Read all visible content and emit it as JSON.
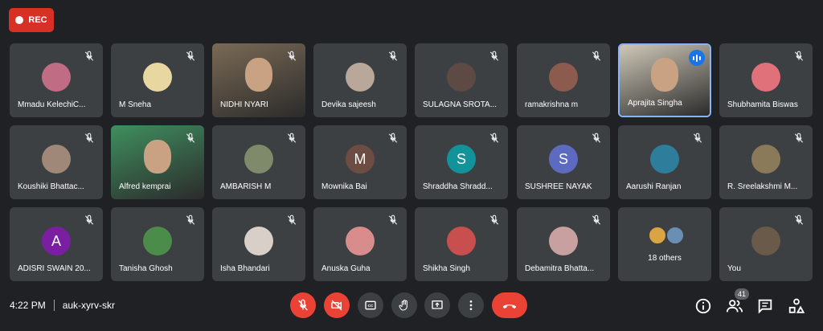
{
  "recording": {
    "label": "REC"
  },
  "participants": [
    {
      "name": "Mmadu KelechiC...",
      "avatar_type": "photo",
      "avatar_color": "#c06c84",
      "muted": true
    },
    {
      "name": "M Sneha",
      "avatar_type": "photo",
      "avatar_color": "#e8d7a0",
      "muted": true
    },
    {
      "name": "NIDHI NYARI",
      "avatar_type": "video",
      "avatar_color": "#7a6a55",
      "muted": true
    },
    {
      "name": "Devika sajeesh",
      "avatar_type": "photo",
      "avatar_color": "#b9a89a",
      "muted": true
    },
    {
      "name": "SULAGNA SROTA...",
      "avatar_type": "photo",
      "avatar_color": "#5d4a44",
      "muted": true
    },
    {
      "name": "ramakrishna m",
      "avatar_type": "photo",
      "avatar_color": "#8d5a4e",
      "muted": true
    },
    {
      "name": "Aprajita Singha",
      "avatar_type": "video",
      "avatar_color": "#cfc8b8",
      "muted": false,
      "speaking": true
    },
    {
      "name": "Shubhamita Biswas",
      "avatar_type": "photo",
      "avatar_color": "#e0707a",
      "muted": true
    },
    {
      "name": "Koushiki Bhattac...",
      "avatar_type": "photo",
      "avatar_color": "#a08878",
      "muted": true
    },
    {
      "name": "Alfred kemprai",
      "avatar_type": "video",
      "avatar_color": "#3f8f5f",
      "muted": true
    },
    {
      "name": "AMBARISH M",
      "avatar_type": "photo",
      "avatar_color": "#7e8a6a",
      "muted": true
    },
    {
      "name": "Mownika Bai",
      "avatar_type": "letter",
      "letter": "M",
      "avatar_color": "#6d4c41",
      "muted": true
    },
    {
      "name": "Shraddha Shradd...",
      "avatar_type": "letter",
      "letter": "S",
      "avatar_color": "#12939a",
      "muted": true
    },
    {
      "name": "SUSHREE NAYAK",
      "avatar_type": "letter",
      "letter": "S",
      "avatar_color": "#5c6bc0",
      "muted": true
    },
    {
      "name": "Aarushi Ranjan",
      "avatar_type": "photo",
      "avatar_color": "#2e7d9a",
      "muted": true
    },
    {
      "name": "R. Sreelakshmi M...",
      "avatar_type": "photo",
      "avatar_color": "#8a7a5a",
      "muted": true
    },
    {
      "name": "ADISRI SWAIN 20...",
      "avatar_type": "letter",
      "letter": "A",
      "avatar_color": "#7b1fa2",
      "muted": true
    },
    {
      "name": "Tanisha Ghosh",
      "avatar_type": "photo",
      "avatar_color": "#4c8c4a",
      "muted": true
    },
    {
      "name": "Isha Bhandari",
      "avatar_type": "photo",
      "avatar_color": "#d8d0c8",
      "muted": true
    },
    {
      "name": "Anuska Guha",
      "avatar_type": "photo",
      "avatar_color": "#d98c8c",
      "muted": true
    },
    {
      "name": "Shikha Singh",
      "avatar_type": "photo",
      "avatar_color": "#c94f4f",
      "muted": true
    },
    {
      "name": "Debamitra Bhatta...",
      "avatar_type": "photo",
      "avatar_color": "#c9a0a0",
      "muted": true
    },
    {
      "name": "18 others",
      "avatar_type": "others",
      "avatar_colors": [
        "#d9a441",
        "#6b8fb3"
      ],
      "muted": false
    },
    {
      "name": "You",
      "avatar_type": "photo",
      "avatar_color": "#6a5a4a",
      "muted": true
    }
  ],
  "bottom_bar": {
    "time": "4:22 PM",
    "meeting_code": "auk-xyrv-skr",
    "people_count": "41",
    "controls": [
      "mic-off-icon",
      "camera-off-icon",
      "captions-icon",
      "raise-hand-icon",
      "present-icon",
      "more-options-icon",
      "hang-up-icon"
    ],
    "right_icons": [
      "info-icon",
      "people-icon",
      "chat-icon",
      "activities-icon"
    ],
    "colors": {
      "danger": "#ea4335",
      "accent": "#1a73e8",
      "panel": "#3c4043",
      "background": "#202124"
    }
  }
}
